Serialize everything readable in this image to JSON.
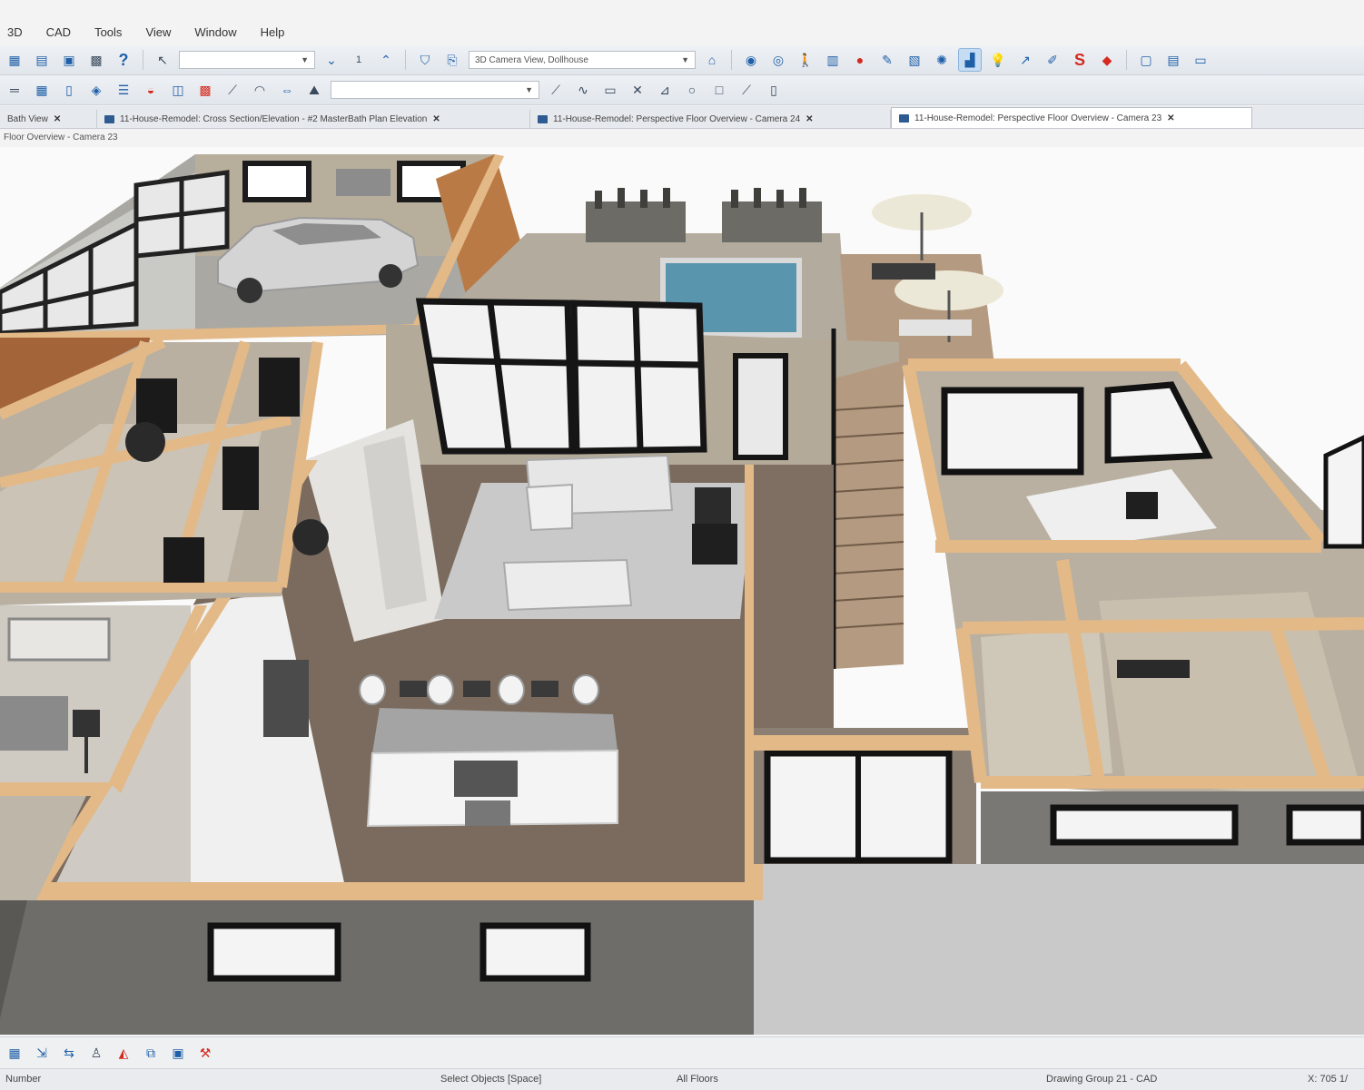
{
  "menu": [
    "3D",
    "CAD",
    "Tools",
    "View",
    "Window",
    "Help"
  ],
  "toolbar": {
    "camera_combo": "3D Camera View, Dollhouse",
    "icons_row1": [
      "save-icon",
      "print-icon",
      "layers-icon",
      "library-icon",
      "help-icon",
      "select-icon",
      "down-arrow-icon",
      "up-arrow-icon",
      "shield-icon",
      "camera-icon",
      "dollhouse-icon",
      "camera-person-icon",
      "walkthrough-icon",
      "record-icon",
      "paint-icon",
      "section-icon",
      "materials-icon",
      "sun-icon",
      "light-icon",
      "tape-icon",
      "dollar-icon",
      "eraser-icon",
      "window-icon"
    ],
    "icons_row2": [
      "wall-icon",
      "cabinet-icon",
      "door-icon",
      "window-icon",
      "stairs-icon",
      "roof-icon",
      "fixture-icon",
      "texture-icon",
      "line-icon",
      "arc-icon",
      "dimension-icon",
      "text-icon",
      "person-icon",
      "polyline-icon",
      "circle-icon",
      "box-icon"
    ]
  },
  "tabs": [
    {
      "label": "Bath View"
    },
    {
      "label": "11-House-Remodel: Cross Section/Elevation - #2 MasterBath Plan Elevation"
    },
    {
      "label": "11-House-Remodel: Perspective Floor Overview - Camera 24"
    },
    {
      "label": "11-House-Remodel: Perspective Floor Overview - Camera 23"
    }
  ],
  "view_title": "Floor Overview - Camera 23",
  "status": {
    "left": "Number",
    "hint": "Select Objects [Space]",
    "floor": "All Floors",
    "group": "Drawing Group 21 - CAD",
    "coords": "X: 705 1/"
  },
  "colors": {
    "wall_top": "#e3b987",
    "wall_face": "#bcb3a3",
    "floor_wood": "#7a6b5e",
    "rug": "#c9c9c9",
    "pool": "#5a95ae",
    "toolbar_bg": "#e6eaef",
    "accent": "#1f5fa8"
  }
}
